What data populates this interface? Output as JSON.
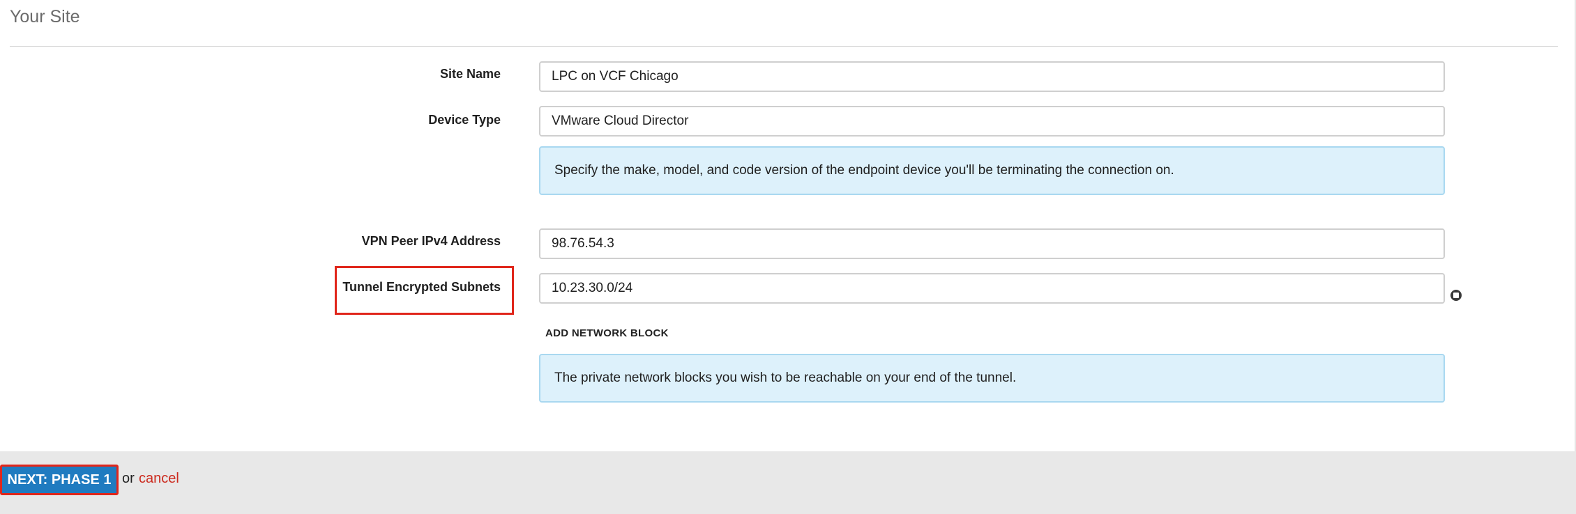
{
  "section": {
    "title": "Your Site"
  },
  "form": {
    "site_name": {
      "label": "Site Name",
      "value": "LPC on VCF Chicago"
    },
    "device_type": {
      "label": "Device Type",
      "value": "VMware Cloud Director",
      "help": "Specify the make, model, and code version of the endpoint device you'll be terminating the connection on."
    },
    "vpn_peer": {
      "label": "VPN Peer IPv4 Address",
      "value": "98.76.54.3"
    },
    "tunnel_subnets": {
      "label": "Tunnel Encrypted Subnets",
      "value": "10.23.30.0/24",
      "add_label": "ADD NETWORK BLOCK",
      "help": "The private network blocks you wish to be reachable on your end of the tunnel."
    }
  },
  "footer": {
    "next_label": "NEXT: PHASE 1",
    "or_text": "or",
    "cancel_label": "cancel"
  },
  "colors": {
    "primary_button": "#1f7bc0",
    "highlight": "#e0261b",
    "cancel_link": "#cc2a1e",
    "help_background": "#ddf1fb"
  },
  "icons": {
    "remove_subnet": "remove-circle-icon"
  }
}
